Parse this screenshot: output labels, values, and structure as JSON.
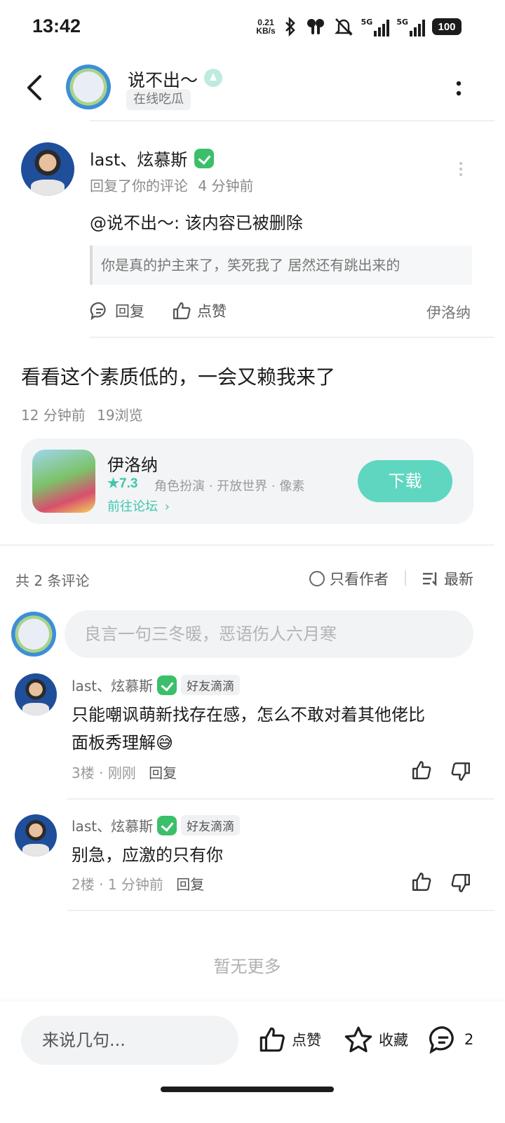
{
  "status_bar": {
    "time": "13:42",
    "net_speed_value": "0.21",
    "net_speed_unit": "KB/s",
    "signal_1": "5G",
    "signal_2": "5G",
    "battery": "100"
  },
  "header": {
    "title": "说不出～",
    "status_tag": "在线吃瓜"
  },
  "reply_notice": {
    "author": "last、炫慕斯",
    "action_text": "回复了你的评论",
    "time": "4 分钟前",
    "content": "@说不出～: 该内容已被删除",
    "quote": "你是真的护主来了，笑死我了 居然还有跳出来的",
    "reply_label": "回复",
    "like_label": "点赞",
    "game_tag": "伊洛纳"
  },
  "post": {
    "title": "看看这个素质低的，一会又赖我来了",
    "time": "12 分钟前",
    "views": "19浏览"
  },
  "game_card": {
    "name": "伊洛纳",
    "rating": "7.3",
    "tags": "角色扮演 · 开放世界 · 像素",
    "forum_link": "前往论坛",
    "download_label": "下载",
    "accent_color": "#5fd6c0"
  },
  "comments_section": {
    "count_label": "共 2 条评论",
    "author_only_label": "只看作者",
    "sort_label": "最新",
    "input_placeholder": "良言一句三冬暖，恶语伤人六月寒",
    "no_more": "暂无更多",
    "comments": [
      {
        "author": "last、炫慕斯",
        "tag": "好友滴滴",
        "text_line_1": "只能嘲讽萌新找存在感，怎么不敢对着其他佬比",
        "text_line_2": "面板秀理解",
        "emoji": "😅",
        "floor": "3楼",
        "time": "刚刚",
        "reply_label": "回复"
      },
      {
        "author": "last、炫慕斯",
        "tag": "好友滴滴",
        "text_line_1": "别急，应激的只有你",
        "floor": "2楼",
        "time": "1 分钟前",
        "reply_label": "回复"
      }
    ]
  },
  "bottom_bar": {
    "input_placeholder": "来说几句...",
    "like_label": "点赞",
    "favorite_label": "收藏",
    "comment_count": "2"
  }
}
